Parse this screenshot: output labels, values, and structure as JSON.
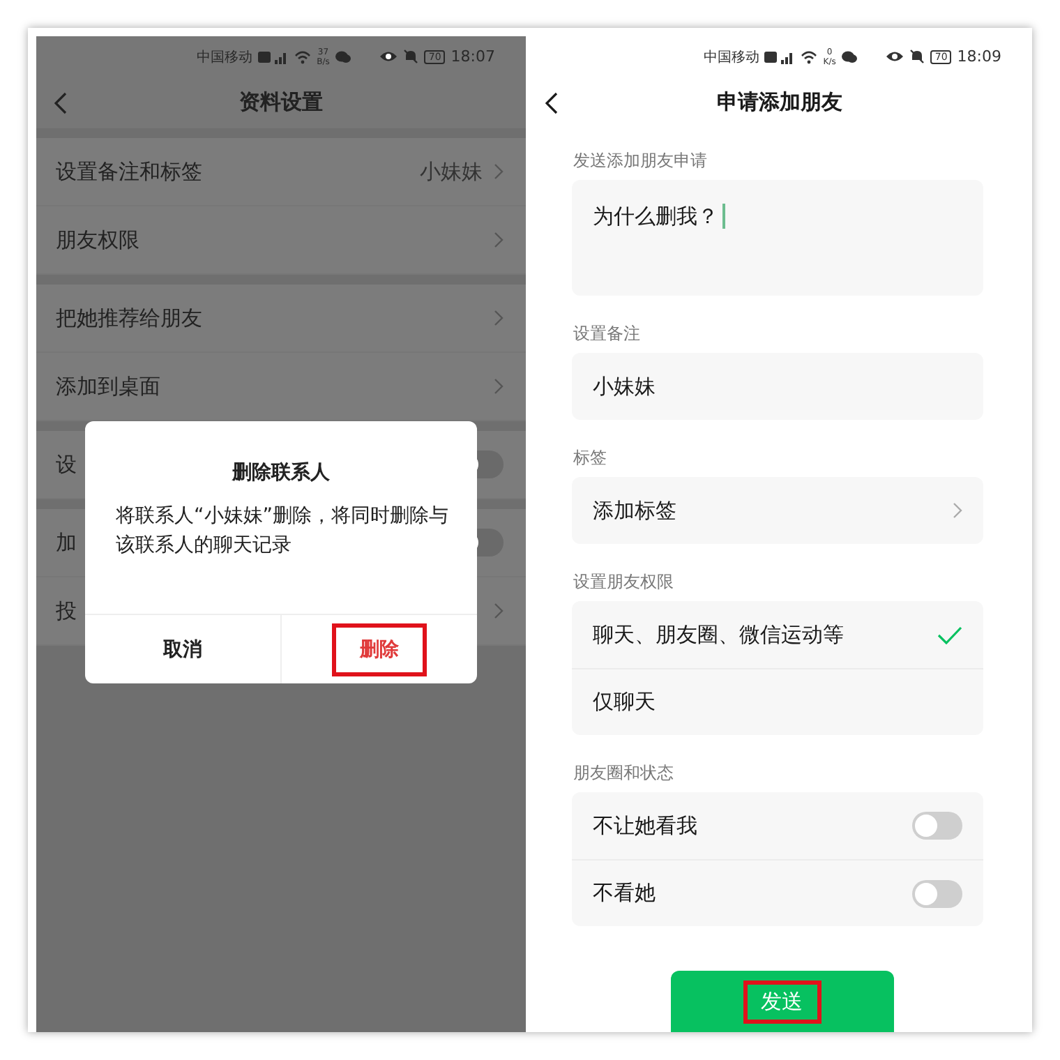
{
  "left_screen": {
    "status_bar": {
      "carrier": "中国移动",
      "speed_value": "37",
      "speed_unit": "B/s",
      "battery": "70",
      "time": "18:07"
    },
    "title": "资料设置",
    "groups": [
      {
        "rows": [
          {
            "kind": "link",
            "label": "设置备注和标签",
            "value": "小妹妹"
          },
          {
            "kind": "link",
            "label": "朋友权限"
          }
        ]
      },
      {
        "rows": [
          {
            "kind": "link",
            "label": "把她推荐给朋友"
          },
          {
            "kind": "link",
            "label": "添加到桌面"
          }
        ]
      },
      {
        "rows": [
          {
            "kind": "toggle",
            "label": "设",
            "on": false
          }
        ]
      },
      {
        "rows": [
          {
            "kind": "toggle",
            "label": "加",
            "on": false
          },
          {
            "kind": "link",
            "label": "投"
          }
        ]
      }
    ],
    "dialog": {
      "title": "删除联系人",
      "message": "将联系人“小妹妹”删除，将同时删除与该联系人的聊天记录",
      "buttons": [
        {
          "label": "取消",
          "kind": "cancel",
          "highlighted": false
        },
        {
          "label": "删除",
          "kind": "danger",
          "highlighted": true
        }
      ]
    }
  },
  "right_screen": {
    "status_bar": {
      "carrier": "中国移动",
      "speed_value": "0",
      "speed_unit": "K/s",
      "battery": "70",
      "time": "18:09"
    },
    "title": "申请添加朋友",
    "sections": [
      {
        "kind": "textarea",
        "label": "发送添加朋友申请",
        "value": "为什么删我？"
      },
      {
        "kind": "input",
        "label": "设置备注",
        "value": "小妹妹"
      },
      {
        "kind": "link",
        "label": "标签",
        "value": "添加标签"
      },
      {
        "kind": "choice",
        "label": "设置朋友权限",
        "options": [
          {
            "label": "聊天、朋友圈、微信运动等",
            "selected": true
          },
          {
            "label": "仅聊天",
            "selected": false
          }
        ]
      },
      {
        "kind": "toggles",
        "label": "朋友圈和状态",
        "options": [
          {
            "label": "不让她看我",
            "on": false
          },
          {
            "label": "不看她",
            "on": false
          }
        ]
      }
    ],
    "send_button": {
      "label": "发送",
      "highlighted": true
    }
  }
}
